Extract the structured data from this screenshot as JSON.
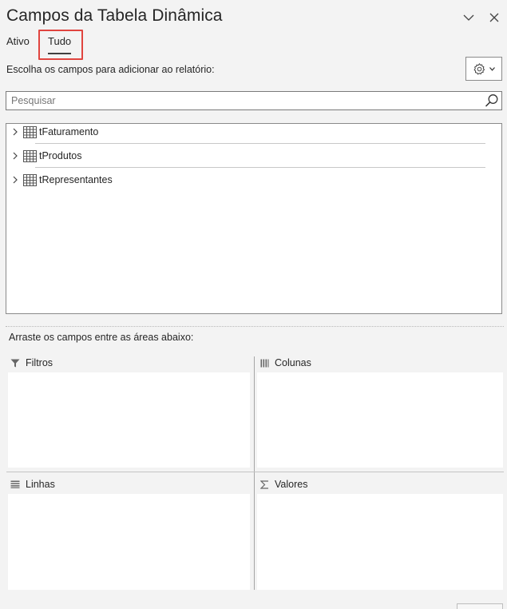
{
  "panel": {
    "title": "Campos da Tabela Dinâmica"
  },
  "tabs": [
    {
      "label": "Ativo",
      "active": false
    },
    {
      "label": "Tudo",
      "active": true
    }
  ],
  "instruction": "Escolha os campos para adicionar ao relatório:",
  "search": {
    "placeholder": "Pesquisar",
    "value": ""
  },
  "fields": [
    {
      "label": "tFaturamento",
      "icon": "table-icon"
    },
    {
      "label": "tProdutos",
      "icon": "table-icon"
    },
    {
      "label": "tRepresentantes",
      "icon": "table-icon"
    }
  ],
  "drag_instruction": "Arraste os campos entre as áreas abaixo:",
  "areas": {
    "filters": {
      "label": "Filtros",
      "icon": "filter-icon"
    },
    "columns": {
      "label": "Colunas",
      "icon": "columns-icon"
    },
    "rows": {
      "label": "Linhas",
      "icon": "rows-icon"
    },
    "values": {
      "label": "Valores",
      "icon": "sigma-icon"
    }
  },
  "colors": {
    "highlight": "#e0443f",
    "background": "#f3f3f3"
  }
}
